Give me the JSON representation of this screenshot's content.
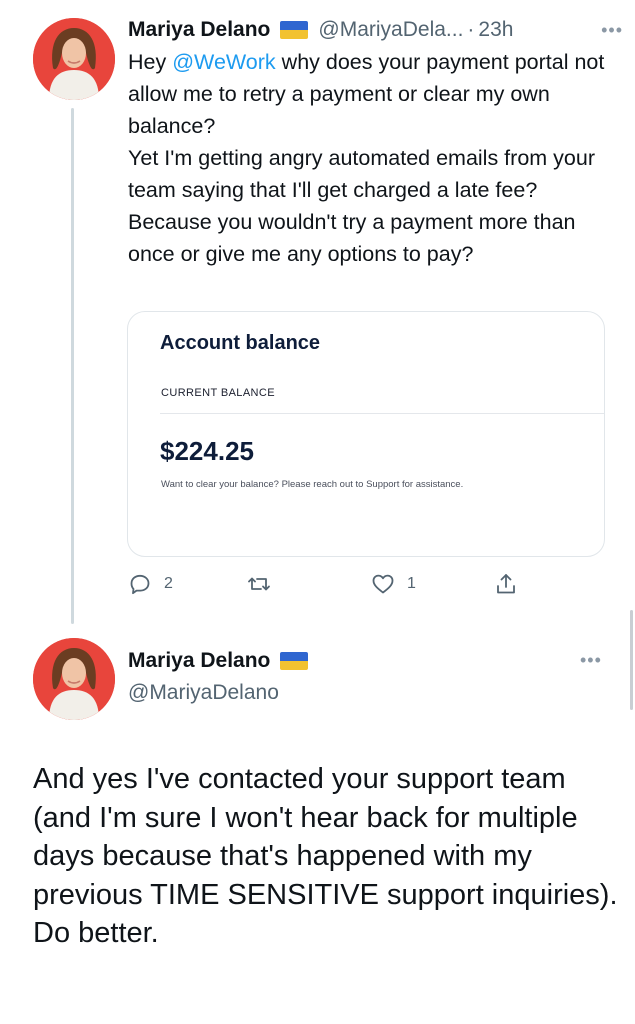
{
  "tweet1": {
    "display_name": "Mariya Delano",
    "handle": "@MariyaDela...",
    "separator": "·",
    "time": "23h",
    "more_label": "•••",
    "body": {
      "line1_prefix": "Hey ",
      "mention": "@WeWork",
      "line1_rest": " why does your payment portal not allow me to retry a payment or clear my own balance?",
      "line2": "Yet I'm getting angry automated emails from your team saying that I'll get charged a late fee? Because you wouldn't try a payment more than once or give me any options to pay?"
    },
    "card": {
      "title": "Account balance",
      "label": "CURRENT BALANCE",
      "amount": "$224.25",
      "note": "Want to clear your balance? Please reach out to Support for assistance."
    },
    "actions": {
      "replies": "2",
      "retweets": "",
      "likes": "1"
    }
  },
  "tweet2": {
    "display_name": "Mariya Delano",
    "handle": "@MariyaDelano",
    "more_label": "•••",
    "body": {
      "line1": "And yes I've contacted your support team (and I'm sure I won't hear back for multiple days because that's happened with my previous TIME SENSITIVE support inquiries).",
      "line2": "Do better."
    }
  },
  "icons": [
    "avatar",
    "flag-ukraine-icon",
    "more-icon",
    "reply-icon",
    "retweet-icon",
    "like-icon",
    "share-icon"
  ],
  "colors": {
    "link": "#1d9bf0",
    "secondary_text": "#536471",
    "avatar_bg": "#e8453c",
    "flag_blue": "#2f66d0",
    "flag_yellow": "#f2c230"
  }
}
